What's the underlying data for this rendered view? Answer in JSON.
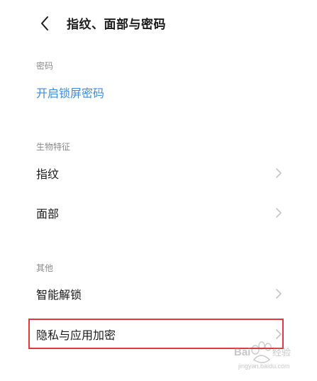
{
  "header": {
    "back_icon": "chevron-left-icon",
    "title": "指纹、面部与密码"
  },
  "sections": {
    "password": {
      "label": "密码",
      "items": [
        {
          "label": "开启锁屏密码",
          "color": "#3b8ddb"
        }
      ]
    },
    "biometrics": {
      "label": "生物特征",
      "items": [
        {
          "label": "指纹"
        },
        {
          "label": "面部"
        }
      ]
    },
    "other": {
      "label": "其他",
      "items": [
        {
          "label": "智能解锁"
        },
        {
          "label": "隐私与应用加密"
        }
      ]
    }
  },
  "highlight_color": "#e0383e",
  "watermark": {
    "brand": "Baidu经验",
    "url": "jingyan.baidu.com"
  }
}
